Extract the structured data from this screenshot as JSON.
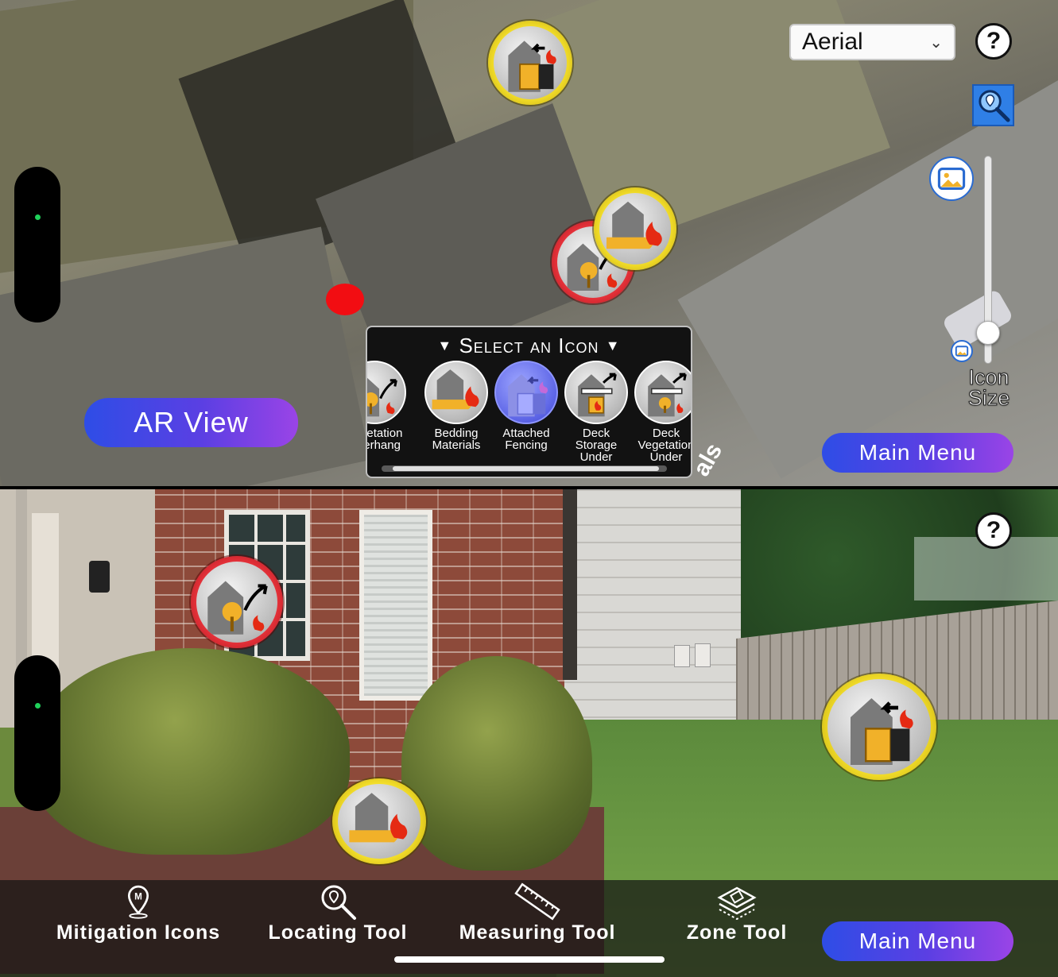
{
  "top_panel": {
    "map_type": {
      "selected": "Aerial"
    },
    "help_label": "?",
    "ar_view_label": "AR View",
    "main_menu_label": "Main Menu",
    "icon_size_label": "Icon\nSize",
    "icon_size_value": 0.2,
    "street_text": "als"
  },
  "picker": {
    "title": "Select an Icon",
    "items": [
      {
        "label": "Vegetation\nOverhang",
        "icon": "vegetation-overhang-icon"
      },
      {
        "label": "Bedding\nMaterials",
        "icon": "bedding-materials-icon"
      },
      {
        "label": "Attached\nFencing",
        "icon": "attached-fencing-icon",
        "selected": true
      },
      {
        "label": "Deck\nStorage\nUnder",
        "icon": "deck-storage-under-icon"
      },
      {
        "label": "Deck\nVegetation\nUnder",
        "icon": "deck-vegetation-under-icon"
      }
    ]
  },
  "bottom_panel": {
    "help_label": "?",
    "tools": [
      {
        "label": "Mitigation Icons",
        "icon": "map-pin-m-icon"
      },
      {
        "label": "Locating Tool",
        "icon": "locate-magnifier-icon"
      },
      {
        "label": "Measuring Tool",
        "icon": "ruler-icon"
      },
      {
        "label": "Zone Tool",
        "icon": "zone-layers-icon"
      }
    ],
    "main_menu_label": "Main Menu"
  },
  "colors": {
    "button_gradient_start": "#2e4de6",
    "button_gradient_end": "#9a44e6",
    "marker_yellow": "#f3de2b",
    "marker_red": "#e8333b",
    "status_dot": "#1fd15a",
    "selected_icon": "#5c64e6"
  }
}
